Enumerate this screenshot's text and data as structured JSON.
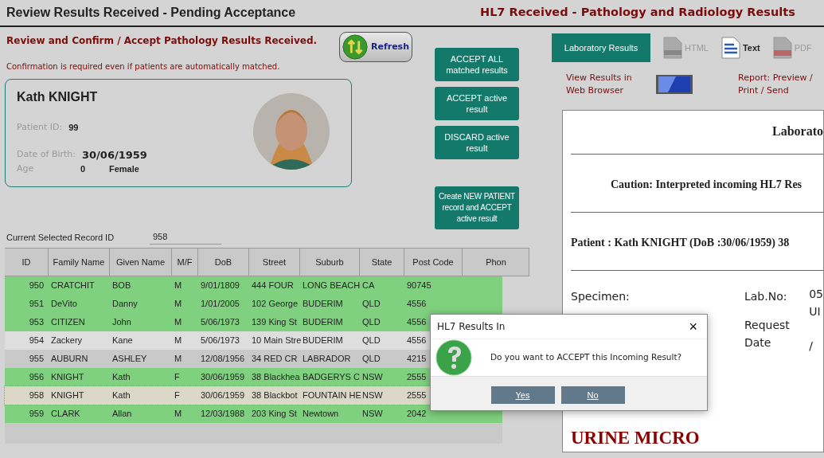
{
  "titles": {
    "left": "Review Results Received - Pending Acceptance",
    "right": "HL7 Received - Pathology and Radiology Results"
  },
  "subtitle": "Review and Confirm / Accept Pathology Results Received.",
  "note": "Confirmation is required even if patients are automatically matched.",
  "refresh": {
    "label": "Refresh"
  },
  "patient": {
    "name": "Kath KNIGHT",
    "id_label": "Patient ID:",
    "id": "99",
    "dob_label": "Date of Birth:",
    "dob": "30/06/1959",
    "age_label": "Age",
    "age": "0",
    "sex": "Female"
  },
  "actions": [
    "ACCEPT ALL matched results",
    "ACCEPT active result",
    "DISCARD active result",
    "Create NEW PATIENT record and ACCEPT active result"
  ],
  "record": {
    "label": "Current Selected Record ID",
    "value": "958"
  },
  "table": {
    "columns": [
      "ID",
      "Family Name",
      "Given Name",
      "M/F",
      "DoB",
      "Street",
      "Suburb",
      "State",
      "Post Code",
      "Phon"
    ],
    "rows": [
      {
        "cells": [
          "950",
          "CRATCHIT",
          "BOB",
          "M",
          "9/01/1809",
          "444 FOUR",
          "LONG BEACH",
          "CA",
          "90745"
        ],
        "color": "#7fd17f",
        "selected": false
      },
      {
        "cells": [
          "951",
          "DeVito",
          "Danny",
          "M",
          "1/01/2005",
          "102 George",
          "BUDERIM",
          "QLD",
          "4556"
        ],
        "color": "#7fd17f",
        "selected": false
      },
      {
        "cells": [
          "953",
          "CITIZEN",
          "John",
          "M",
          "5/06/1973",
          "139 King St",
          "BUDERIM",
          "QLD",
          "4556"
        ],
        "color": "#7fd17f",
        "selected": false
      },
      {
        "cells": [
          "954",
          "Zackery",
          "Kane",
          "M",
          "5/06/1973",
          "10 Main Stre",
          "BUDERIM",
          "QLD",
          "4556"
        ],
        "color": "#dedede",
        "selected": false
      },
      {
        "cells": [
          "955",
          "AUBURN",
          "ASHLEY",
          "M",
          "12/08/1956",
          "34 RED CR",
          "LABRADOR",
          "QLD",
          "4215"
        ],
        "color": "#c9c9c9",
        "selected": false
      },
      {
        "cells": [
          "956",
          "KNIGHT",
          "Kath",
          "F",
          "30/06/1959",
          "38 Blackhea",
          "BADGERYS C",
          "NSW",
          "2555"
        ],
        "color": "#7fd17f",
        "selected": false
      },
      {
        "cells": [
          "958",
          "KNIGHT",
          "Kath",
          "F",
          "30/06/1959",
          "38 Blackbot",
          "FOUNTAIN HE",
          "NSW",
          "2555"
        ],
        "color": "#dcd8c8",
        "selected": true
      },
      {
        "cells": [
          "959",
          "CLARK",
          "Allan",
          "M",
          "12/03/1988",
          "203 King St",
          "Newtown",
          "NSW",
          "2042"
        ],
        "color": "#7fd17f",
        "selected": false
      }
    ]
  },
  "tabs": [
    {
      "label": "Laboratory Results",
      "kind": "button",
      "selected": true,
      "disabled": false
    },
    {
      "label": "HTML",
      "kind": "doc",
      "selected": false,
      "disabled": true
    },
    {
      "label": "Text",
      "kind": "lines",
      "selected": false,
      "disabled": false
    },
    {
      "label": "PDF",
      "kind": "pdf",
      "selected": false,
      "disabled": true
    }
  ],
  "links": {
    "browser": "View Results in Web Browser",
    "report": "Report: Preview / Print / Send"
  },
  "report": {
    "title": "Laborato",
    "caution": "Caution: Interpreted incoming HL7 Res",
    "patient_line": "Patient : Kath KNIGHT (DoB :30/06/1959) 38",
    "specimen_label": "Specimen:",
    "labno_label": "Lab.No:",
    "labno_lines": [
      "05",
      "UI"
    ],
    "request_label": "Request Date",
    "request_value": "/",
    "section": "URINE MICRO"
  },
  "dialog": {
    "title": "HL7 Results In",
    "close": "×",
    "message": "Do you want to ACCEPT this Incoming Result?",
    "buttons": [
      "Yes",
      "No"
    ]
  }
}
